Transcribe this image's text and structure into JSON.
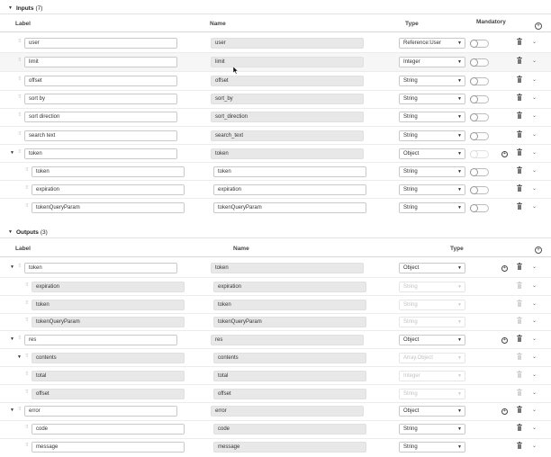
{
  "inputs_section": {
    "title": "Inputs",
    "count": "(7)"
  },
  "inputs_columns": {
    "label": "Label",
    "name": "Name",
    "type": "Type",
    "mandatory": "Mandatory"
  },
  "outputs_section": {
    "title": "Outputs",
    "count": "(3)"
  },
  "outputs_columns": {
    "label": "Label",
    "name": "Name",
    "type": "Type"
  },
  "inputs": [
    {
      "label": "user",
      "name": "user",
      "type": "Reference:User",
      "mandatory": false
    },
    {
      "label": "limit",
      "name": "limit",
      "type": "Integer",
      "mandatory": false
    },
    {
      "label": "offset",
      "name": "offset",
      "type": "String",
      "mandatory": false
    },
    {
      "label": "sort by",
      "name": "sort_by",
      "type": "String",
      "mandatory": false
    },
    {
      "label": "sort direction",
      "name": "sort_direction",
      "type": "String",
      "mandatory": false
    },
    {
      "label": "search text",
      "name": "search_text",
      "type": "String",
      "mandatory": false
    },
    {
      "label": "token",
      "name": "token",
      "type": "Object",
      "mandatory": false
    },
    {
      "label": "token",
      "name": "token",
      "type": "String",
      "mandatory": false
    },
    {
      "label": "expiration",
      "name": "expiration",
      "type": "String",
      "mandatory": false
    },
    {
      "label": "tokenQueryParam",
      "name": "tokenQueryParam",
      "type": "String",
      "mandatory": false
    }
  ],
  "outputs": [
    {
      "label": "token",
      "name": "token",
      "type": "Object"
    },
    {
      "label": "expiration",
      "name": "expiration",
      "type": "String"
    },
    {
      "label": "token",
      "name": "token",
      "type": "String"
    },
    {
      "label": "tokenQueryParam",
      "name": "tokenQueryParam",
      "type": "String"
    },
    {
      "label": "res",
      "name": "res",
      "type": "Object"
    },
    {
      "label": "contents",
      "name": "contents",
      "type": "Array.Object"
    },
    {
      "label": "total",
      "name": "total",
      "type": "Integer"
    },
    {
      "label": "offset",
      "name": "offset",
      "type": "String"
    },
    {
      "label": "error",
      "name": "error",
      "type": "Object"
    },
    {
      "label": "code",
      "name": "code",
      "type": "String"
    },
    {
      "label": "message",
      "name": "message",
      "type": "String"
    }
  ]
}
